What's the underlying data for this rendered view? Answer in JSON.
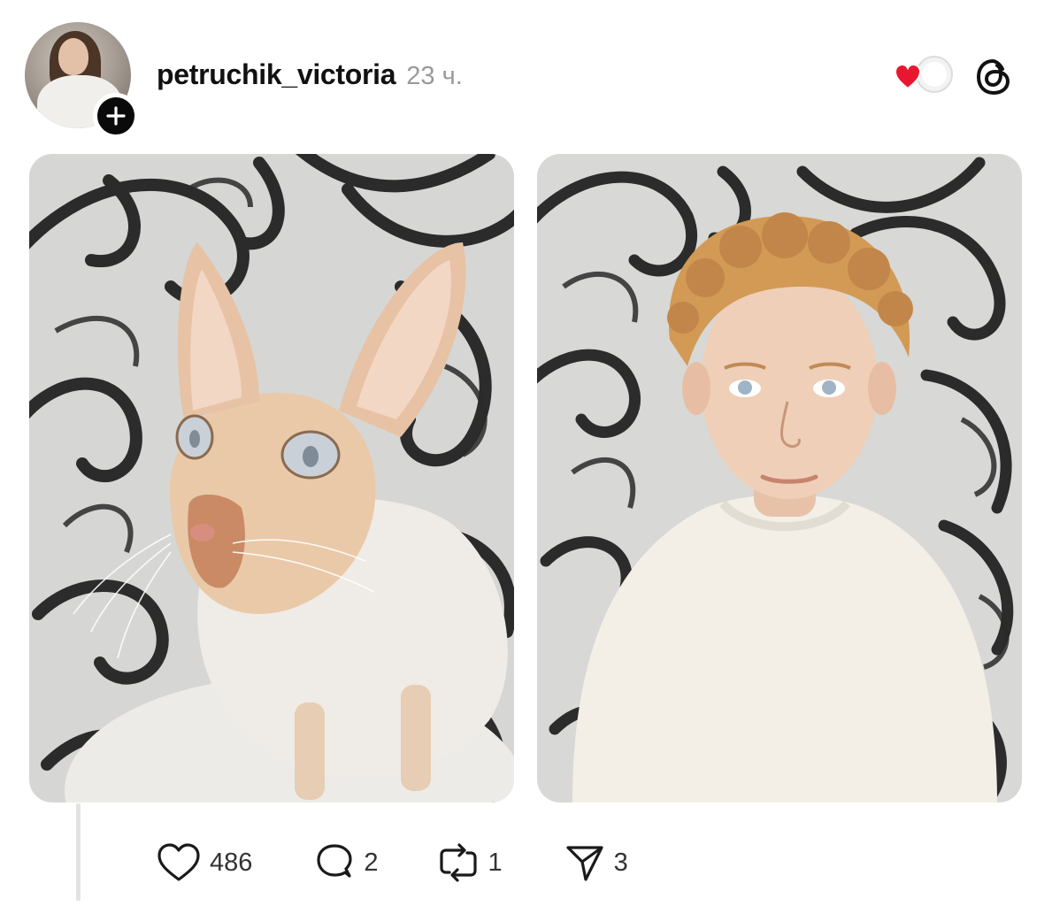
{
  "post": {
    "username": "petruchik_victoria",
    "timestamp": "23 ч.",
    "avatar_icon": "profile-photo",
    "follow_icon": "plus-icon",
    "reaction_icon": "heart-reaction-icon",
    "app_icon": "threads-logo-icon",
    "media": [
      {
        "description_icon": "cat-photo"
      },
      {
        "description_icon": "man-photo"
      }
    ],
    "actions": {
      "likes": "486",
      "replies": "2",
      "reposts": "1",
      "shares": "3"
    },
    "colors": {
      "heart_red": "#e8172f",
      "text_primary": "#111111",
      "text_secondary": "#9a9a9a",
      "thread_line": "#e3e3e3"
    }
  }
}
